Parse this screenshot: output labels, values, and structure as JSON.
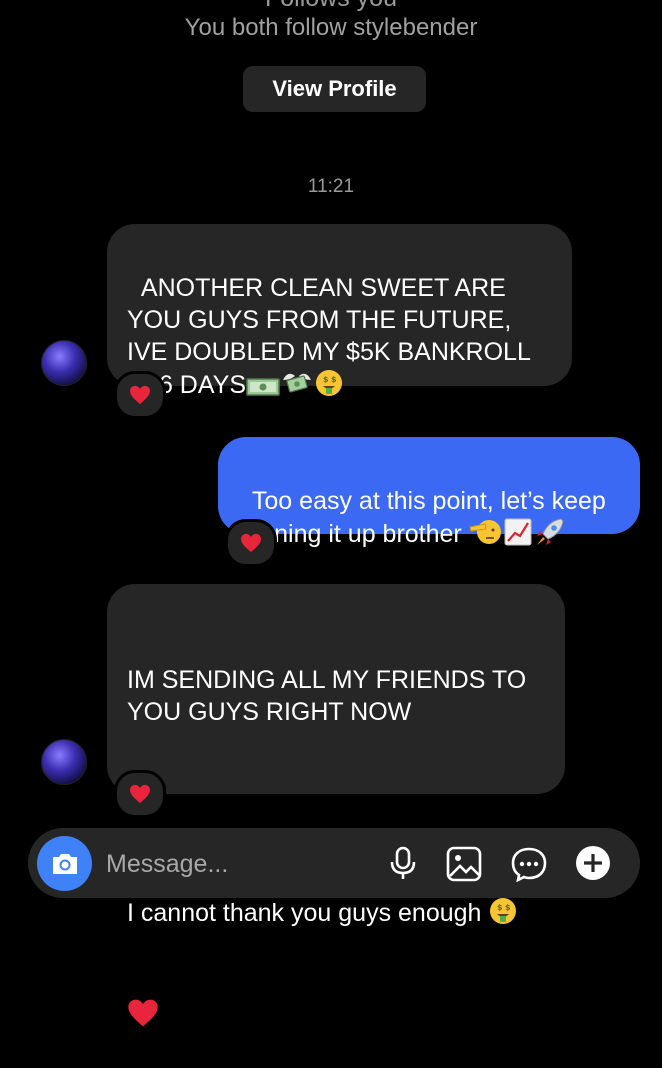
{
  "header": {
    "follows_partial": "Follows you",
    "mutual_text": "You both follow stylebender",
    "view_profile_label": "View Profile"
  },
  "timestamp": "11:21",
  "messages": [
    {
      "direction": "incoming",
      "text": "ANOTHER CLEAN SWEET ARE YOU GUYS FROM THE FUTURE, IVE DOUBLED MY $5K BANKROLL IN 6 DAYS",
      "emojis": [
        "money-bills",
        "money-with-wings",
        "money-mouth-face"
      ],
      "reaction": "red-heart"
    },
    {
      "direction": "outgoing",
      "text": "Too easy at this point, let’s keep running it up brother",
      "emojis": [
        "saluting-face",
        "chart-increasing",
        "rocket"
      ],
      "reaction": "red-heart"
    },
    {
      "direction": "incoming",
      "text_line_1": "IM SENDING ALL MY FRIENDS TO YOU GUYS RIGHT NOW",
      "text_line_2": "I cannot thank you guys enough",
      "emojis": [
        "money-mouth-face",
        "red-heart"
      ],
      "reaction": "red-heart"
    }
  ],
  "composer": {
    "placeholder": "Message...",
    "icons": [
      "camera-icon",
      "microphone-icon",
      "gallery-icon",
      "sticker-icon",
      "plus-icon"
    ]
  },
  "colors": {
    "background": "#000000",
    "incoming_bubble": "#262626",
    "outgoing_bubble": "#3b69f4",
    "camera_button": "#3f82f7",
    "heart": "#e8253a"
  }
}
